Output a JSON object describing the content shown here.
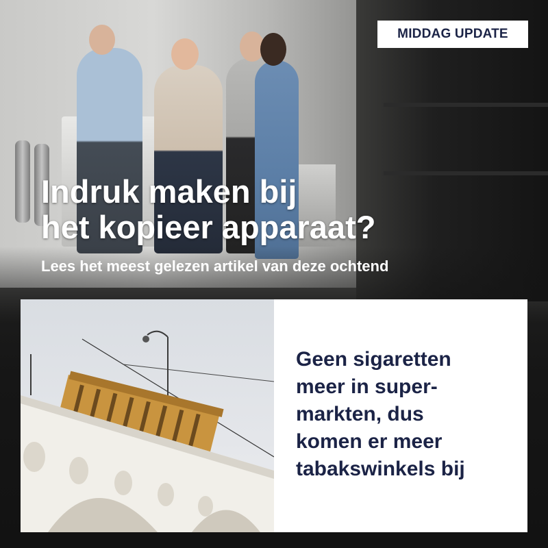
{
  "badge": {
    "label": "MIDDAG UPDATE"
  },
  "hero": {
    "headline_line1": "Indruk maken bij",
    "headline_line2": "het kopieer apparaat?",
    "subline": "Lees het meest gelezen artikel van deze ochtend"
  },
  "card": {
    "line1": "Geen sigaretten",
    "line2": "meer in super-",
    "line3": "markten, dus",
    "line4": "komen er meer",
    "line5": "tabakswinkels bij"
  },
  "colors": {
    "navy_text": "#1b2346",
    "white": "#ffffff",
    "tram_body": "#c9943f"
  }
}
